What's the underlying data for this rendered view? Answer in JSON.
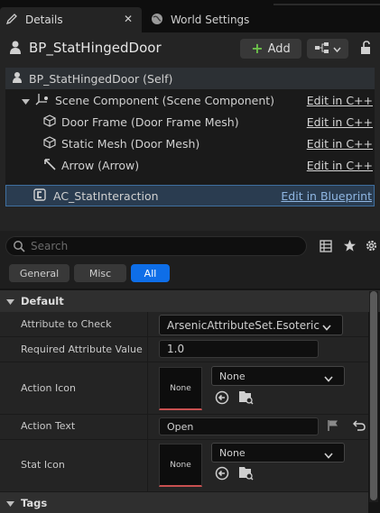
{
  "tabs": {
    "details": "Details",
    "world_settings": "World Settings",
    "close_glyph": "✕"
  },
  "header": {
    "blueprint_name": "BP_StatHingedDoor",
    "add_label": "Add"
  },
  "components": {
    "self": "BP_StatHingedDoor (Self)",
    "items": [
      {
        "label": "Scene Component (Scene Component)",
        "link": "Edit in C++"
      },
      {
        "label": "Door Frame (Door Frame Mesh)",
        "link": "Edit in C++"
      },
      {
        "label": "Static Mesh (Door Mesh)",
        "link": "Edit in C++"
      },
      {
        "label": "Arrow (Arrow)",
        "link": "Edit in C++"
      }
    ],
    "selected": {
      "label": "AC_StatInteraction",
      "link": "Edit in Blueprint"
    }
  },
  "search": {
    "placeholder": "Search"
  },
  "filters": {
    "general": "General",
    "misc": "Misc",
    "all": "All"
  },
  "sections": {
    "default": "Default",
    "tags": "Tags"
  },
  "properties": {
    "attribute_to_check": {
      "label": "Attribute to Check",
      "value": "ArsenicAttributeSet.Esoteric"
    },
    "required_value": {
      "label": "Required Attribute Value",
      "value": "1.0"
    },
    "action_icon": {
      "label": "Action Icon",
      "thumb": "None",
      "combo": "None"
    },
    "action_text": {
      "label": "Action Text",
      "value": "Open"
    },
    "stat_icon": {
      "label": "Stat Icon",
      "thumb": "None",
      "combo": "None"
    }
  },
  "colors": {
    "accent": "#0e6ee8",
    "add_plus": "#6cc04a",
    "link_blue": "#8fb6e2"
  }
}
